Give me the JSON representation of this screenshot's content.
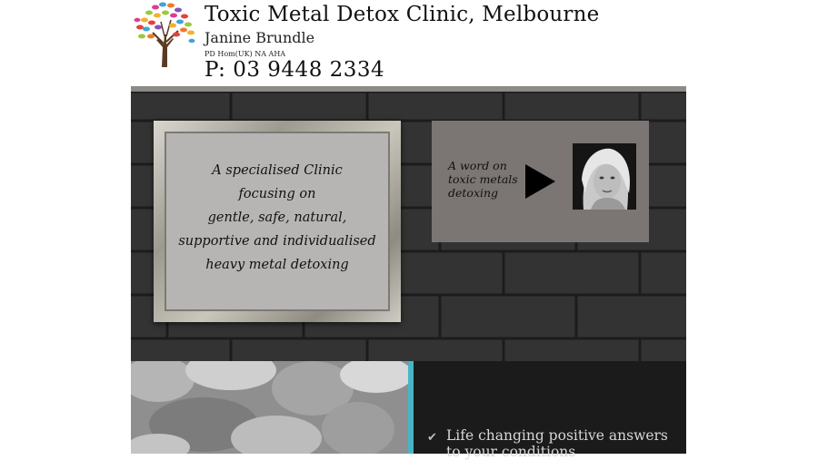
{
  "header": {
    "clinic_name": "Toxic Metal Detox Clinic, Melbourne",
    "practitioner": "Janine Brundle",
    "qualifications": "PD Hom(UK) NA AHA",
    "phone": "P: 03 9448 2334",
    "logo_icon": "tree-logo-icon"
  },
  "hero": {
    "framed_lines": [
      "A specialised Clinic",
      "focusing on",
      "gentle, safe, natural,",
      "supportive and individualised",
      "heavy metal detoxing"
    ],
    "video": {
      "lines": [
        "A word on",
        "toxic metals",
        "detoxing"
      ],
      "play_icon": "play-icon",
      "portrait_icon": "portrait-photo"
    }
  },
  "features": {
    "accent_color": "#48b5c6",
    "items": [
      {
        "icon": "check-icon",
        "text": "Life changing positive answers to your conditions"
      }
    ]
  }
}
